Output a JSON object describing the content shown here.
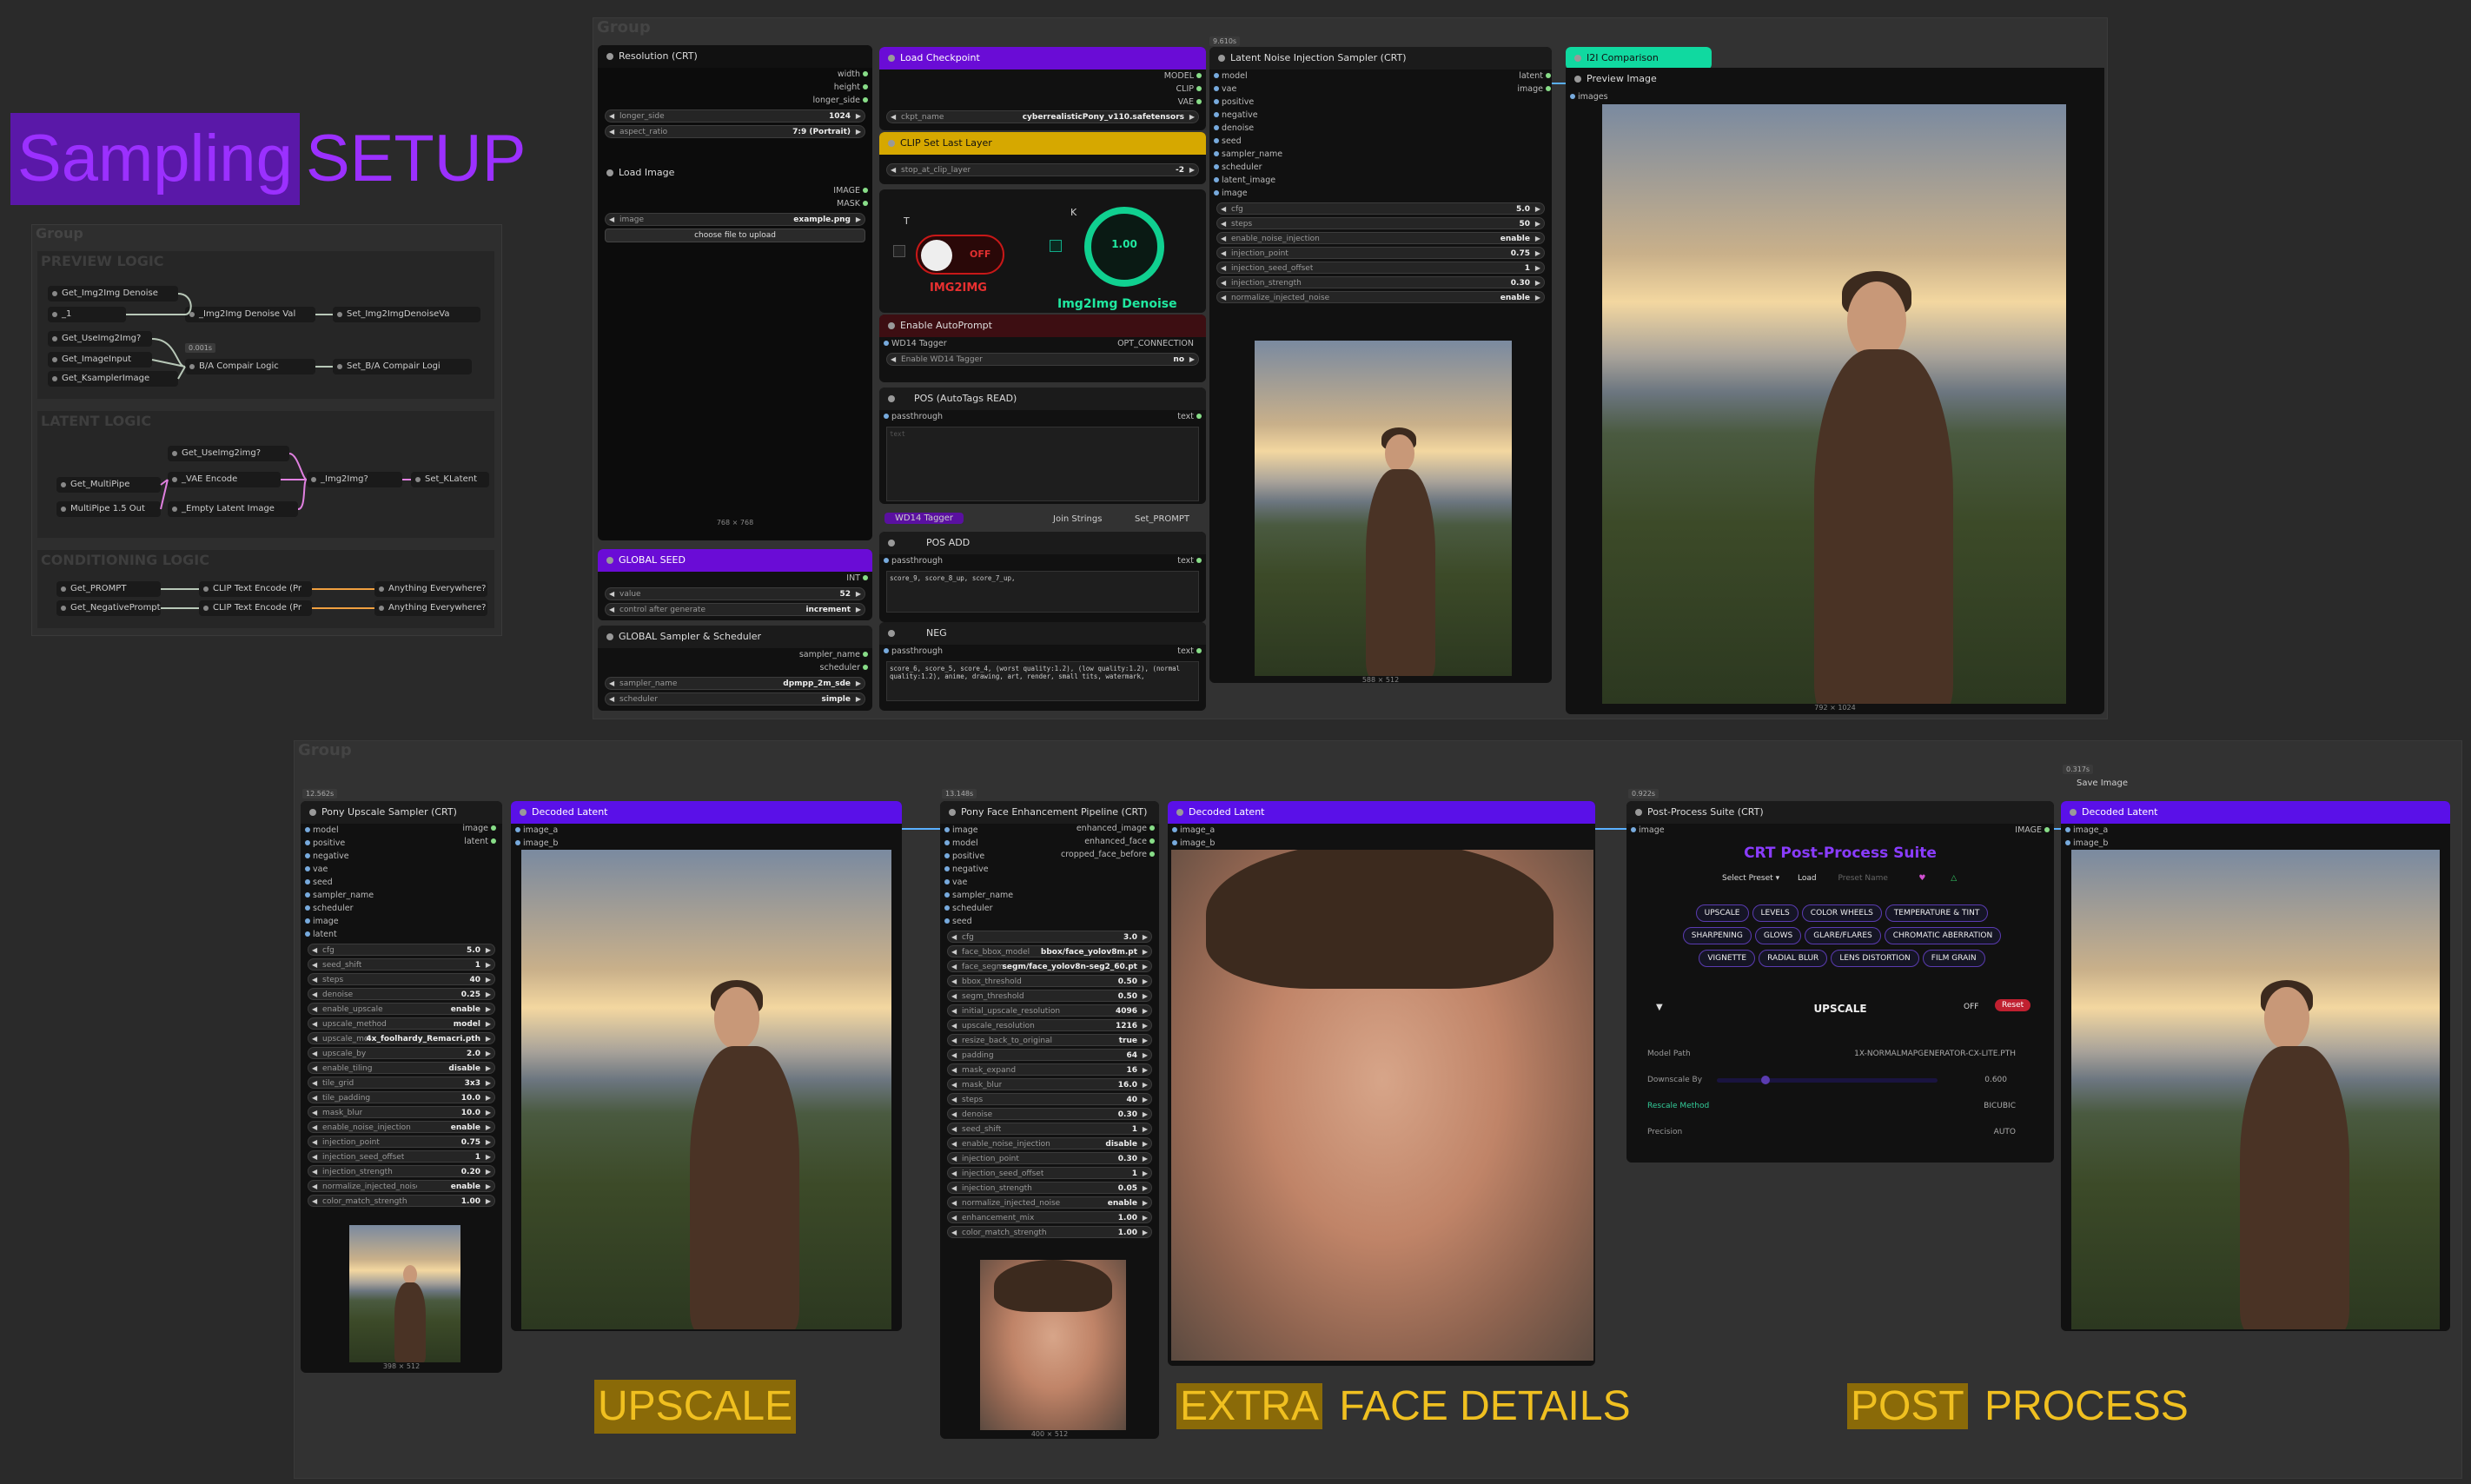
{
  "title": {
    "a": "Sampling",
    "b": "SETUP"
  },
  "group_label": "Group",
  "sections": {
    "preview": "PREVIEW LOGIC",
    "latent": "LATENT LOGIC",
    "conditioning": "CONDITIONING LOGIC"
  },
  "logic": {
    "preview": [
      "Get_Img2Img Denoise",
      "_1",
      "_Img2Img Denoise Val",
      "Set_Img2ImgDenoiseVa",
      "Get_UseImg2Img?",
      "Get_ImageInput",
      "Get_KsamplerImage",
      "B/A Compair Logic",
      "Set_B/A Compair Logi",
      "0.001s"
    ],
    "latent": [
      "Get_UseImg2img?",
      "Get_MultiPipe",
      "MultiPipe 1.5 Out",
      "_VAE Encode",
      "_Empty Latent Image",
      "_Img2Img?",
      "Set_KLatent"
    ],
    "conditioning": [
      "Get_PROMPT",
      "Get_NegativePrompt",
      "CLIP Text Encode (Pr",
      "CLIP Text Encode (Pr",
      "Anything Everywhere?",
      "Anything Everywhere?"
    ]
  },
  "resolution": {
    "title": "Resolution (CRT)",
    "outs": [
      "width",
      "height",
      "longer_side"
    ],
    "w": [
      [
        "longer_side",
        "1024"
      ],
      [
        "aspect_ratio",
        "7:9 (Portrait)"
      ]
    ]
  },
  "load_image": {
    "title": "Load Image",
    "outs": [
      "IMAGE",
      "MASK"
    ],
    "w": [
      [
        "image",
        "example.png"
      ]
    ],
    "button": "choose file to upload",
    "size": "768 × 768"
  },
  "global_seed": {
    "title": "GLOBAL SEED",
    "out": "INT",
    "w": [
      [
        "value",
        "52"
      ],
      [
        "control after generate",
        "increment"
      ]
    ]
  },
  "global_sampler": {
    "title": "GLOBAL Sampler & Scheduler",
    "outs": [
      "sampler_name",
      "scheduler"
    ],
    "w": [
      [
        "sampler_name",
        "dpmpp_2m_sde"
      ],
      [
        "scheduler",
        "simple"
      ]
    ]
  },
  "checkpoint": {
    "title": "Load Checkpoint",
    "outs": [
      "MODEL",
      "CLIP",
      "VAE"
    ],
    "w": [
      [
        "ckpt_name",
        "cyberrealisticPony_v110.safetensors"
      ]
    ]
  },
  "clip_last": {
    "title": "CLIP Set Last Layer",
    "w": [
      [
        "stop_at_clip_layer",
        "-2"
      ]
    ]
  },
  "toggle": {
    "t": "T",
    "k": "K",
    "off": "OFF",
    "label": "IMG2IMG",
    "dial": "1.00",
    "dial_label": "Img2Img Denoise"
  },
  "autoprompt": {
    "title": "Enable AutoPrompt",
    "tagger": "WD14 Tagger",
    "out": "OPT_CONNECTION",
    "w_label": "Enable WD14 Tagger",
    "w_val": "no"
  },
  "pos_auto": {
    "title": "POS (AutoTags READ)",
    "in": "passthrough",
    "out": "text",
    "placeholder": "text"
  },
  "join": {
    "tagger": "WD14 Tagger",
    "join": "Join Strings",
    "set": "Set_PROMPT"
  },
  "pos_add": {
    "title": "POS ADD",
    "in": "passthrough",
    "out": "text",
    "text": "score_9, score_8_up, score_7_up,"
  },
  "neg": {
    "title": "NEG",
    "in": "passthrough",
    "out": "text",
    "text": "score_6, score_5, score_4, (worst quality:1.2), (low quality:1.2), (normal quality:1.2), anime, drawing, art, render, small tits, watermark,"
  },
  "latent_sampler": {
    "title": "Latent Noise Injection Sampler (CRT)",
    "timer": "9.610s",
    "ins": [
      "model",
      "vae",
      "positive",
      "negative",
      "denoise",
      "seed",
      "sampler_name",
      "scheduler",
      "latent_image",
      "image"
    ],
    "w": [
      [
        "cfg",
        "5.0"
      ],
      [
        "steps",
        "50"
      ],
      [
        "enable_noise_injection",
        "enable"
      ],
      [
        "injection_point",
        "0.75"
      ],
      [
        "injection_seed_offset",
        "1"
      ],
      [
        "injection_strength",
        "0.30"
      ],
      [
        "normalize_injected_noise",
        "enable"
      ]
    ],
    "size": "588 × 512"
  },
  "i2i": {
    "title": "I2I Comparison",
    "ins": [
      "latent",
      "image"
    ]
  },
  "preview": {
    "title": "Preview Image",
    "in": "images",
    "size": "792 × 1024"
  },
  "upscale": {
    "title": "Pony Upscale Sampler (CRT)",
    "timer": "12.562s",
    "ins": [
      "model",
      "positive",
      "negative",
      "vae",
      "seed",
      "sampler_name",
      "scheduler",
      "image",
      "latent"
    ],
    "outs": [
      "image",
      "latent"
    ],
    "w": [
      [
        "cfg",
        "5.0"
      ],
      [
        "seed_shift",
        "1"
      ],
      [
        "steps",
        "40"
      ],
      [
        "denoise",
        "0.25"
      ],
      [
        "enable_upscale",
        "enable"
      ],
      [
        "upscale_method",
        "model"
      ],
      [
        "upscale_mo...",
        "4x_foolhardy_Remacri.pth"
      ],
      [
        "upscale_by",
        "2.0"
      ],
      [
        "enable_tiling",
        "disable"
      ],
      [
        "tile_grid",
        "3x3"
      ],
      [
        "tile_padding",
        "10.0"
      ],
      [
        "mask_blur",
        "10.0"
      ],
      [
        "enable_noise_injection",
        "enable"
      ],
      [
        "injection_point",
        "0.75"
      ],
      [
        "injection_seed_offset",
        "1"
      ],
      [
        "injection_strength",
        "0.20"
      ],
      [
        "normalize_injected_noise",
        "enable"
      ],
      [
        "color_match_strength",
        "1.00"
      ]
    ],
    "size": "398 × 512"
  },
  "decoded": {
    "title": "Decoded Latent",
    "ins": [
      "image_a",
      "image_b"
    ]
  },
  "face": {
    "title": "Pony Face Enhancement Pipeline (CRT)",
    "timer": "13.148s",
    "ins": [
      "image",
      "model",
      "positive",
      "negative",
      "vae",
      "sampler_name",
      "scheduler",
      "seed"
    ],
    "outs": [
      "enhanced_image",
      "enhanced_face",
      "cropped_face_before"
    ],
    "w": [
      [
        "cfg",
        "3.0"
      ],
      [
        "face_bbox_model",
        "bbox/face_yolov8m.pt"
      ],
      [
        "face_segm...",
        "segm/face_yolov8n-seg2_60.pt"
      ],
      [
        "bbox_threshold",
        "0.50"
      ],
      [
        "segm_threshold",
        "0.50"
      ],
      [
        "initial_upscale_resolution",
        "4096"
      ],
      [
        "upscale_resolution",
        "1216"
      ],
      [
        "resize_back_to_original",
        "true"
      ],
      [
        "padding",
        "64"
      ],
      [
        "mask_expand",
        "16"
      ],
      [
        "mask_blur",
        "16.0"
      ],
      [
        "steps",
        "40"
      ],
      [
        "denoise",
        "0.30"
      ],
      [
        "seed_shift",
        "1"
      ],
      [
        "enable_noise_injection",
        "disable"
      ],
      [
        "injection_point",
        "0.30"
      ],
      [
        "injection_seed_offset",
        "1"
      ],
      [
        "injection_strength",
        "0.05"
      ],
      [
        "normalize_injected_noise",
        "enable"
      ],
      [
        "enhancement_mix",
        "1.00"
      ],
      [
        "color_match_strength",
        "1.00"
      ]
    ],
    "size": "400 × 512"
  },
  "post": {
    "title": "Post-Process Suite (CRT)",
    "timer": "0.922s",
    "in": "image",
    "out": "IMAGE",
    "suite": "CRT Post-Process Suite",
    "preset": "Select Preset",
    "load": "Load",
    "preset_name": "Preset Name",
    "tabs": [
      "UPSCALE",
      "LEVELS",
      "COLOR WHEELS",
      "TEMPERATURE & TINT",
      "SHARPENING",
      "GLOWS",
      "GLARE/FLARES",
      "CHROMATIC ABERRATION",
      "VIGNETTE",
      "RADIAL BLUR",
      "LENS DISTORTION",
      "FILM GRAIN"
    ],
    "section": "UPSCALE",
    "off": "OFF",
    "reset": "Reset",
    "rows": [
      [
        "Model Path",
        "1X-NORMALMAPGENERATOR-CX-LITE.PTH"
      ],
      [
        "Downscale By",
        "0.600"
      ],
      [
        "Rescale Method",
        "BICUBIC"
      ],
      [
        "Precision",
        "AUTO"
      ]
    ]
  },
  "save": {
    "title": "Save Image",
    "timer": "0.317s"
  },
  "labels": {
    "upscale": "UPSCALE",
    "extra": "EXTRA",
    "face_details": "FACE DETAILS",
    "post": "POST",
    "process": "PROCESS"
  },
  "colors": {
    "accent_purple": "#6a0cd6",
    "accent_violet": "#5a10e8",
    "label_yellow": "#e2b400",
    "teal": "#10d9a0"
  }
}
